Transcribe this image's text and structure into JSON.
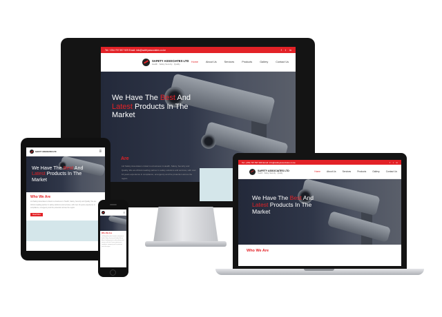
{
  "site": {
    "topbar_contact": "Tel: +254 797 597 929 Email: info@safetyassociates.co.ke",
    "logo_name": "SAFETY ASSOCIATES LTD",
    "logo_tagline": "Health · Safety·Security · Quality",
    "nav": [
      "Home",
      "About Us",
      "Services",
      "Products",
      "Gallery",
      "Contact Us"
    ],
    "hero": {
      "line1": "We Have The ",
      "highlight1": "Best",
      "line2": " And",
      "highlight2": "Latest",
      "line3": " Products In The",
      "line4": "Market"
    },
    "section_title_prefix": "Who We",
    "section_title_suffix": " Are",
    "section_title_full": "Who We Are",
    "cta_label": "Read More",
    "about_fragment": "Ltd Safety Associates Limited is a business in Health, Safety, Security and Quality. We are Africa's leading partner in safety solutions and services, with over 10 years experience in compliance, emergency and fire protection across the region."
  },
  "colors": {
    "brand_red": "#e32227",
    "device_frame": "#141414",
    "hero_bg": "#2f3648"
  },
  "icons": {
    "social": [
      "facebook-icon",
      "twitter-icon",
      "linkedin-icon"
    ],
    "logo": "safety-logo-icon"
  }
}
